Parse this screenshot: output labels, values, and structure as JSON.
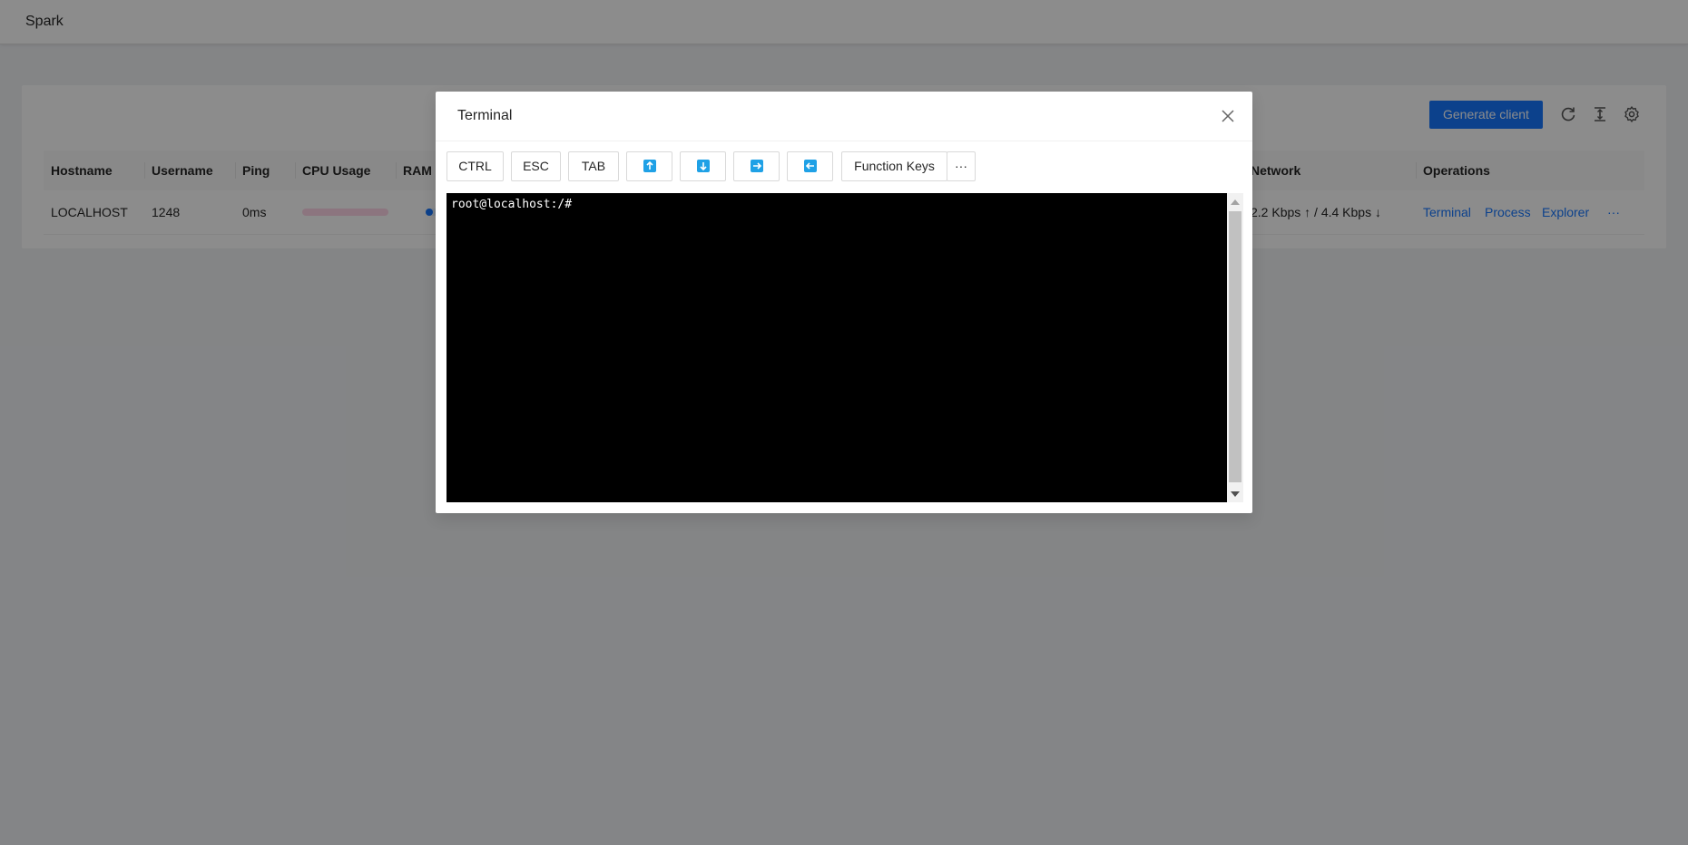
{
  "app": {
    "title": "Spark"
  },
  "toolbar": {
    "generate_label": "Generate client",
    "icons": [
      "reload-icon",
      "column-height-icon",
      "settings-icon"
    ]
  },
  "table": {
    "columns": [
      "Hostname",
      "Username",
      "Ping",
      "CPU Usage",
      "RAM",
      "Network",
      "Operations"
    ],
    "rows": [
      {
        "hostname": "LOCALHOST",
        "username": "1248",
        "ping": "0ms",
        "cpu_usage_fraction": 0.0,
        "ram_usage_fraction": 0.05,
        "network": "2.2 Kbps ↑ / 4.4 Kbps ↓",
        "operations": [
          "Terminal",
          "Process",
          "Explorer",
          "···"
        ]
      }
    ]
  },
  "colors": {
    "primary": "#1677ff",
    "progress_track": "#ffd6e7",
    "terminal_bg": "#000000",
    "arrow_key": "#1fa1e6"
  },
  "modal": {
    "title": "Terminal",
    "keys": {
      "ctrl": "CTRL",
      "esc": "ESC",
      "tab": "TAB",
      "function_keys": "Function Keys",
      "more": "···"
    },
    "arrow_keys": [
      "arrow-up-icon",
      "arrow-down-icon",
      "arrow-right-icon",
      "arrow-left-icon"
    ],
    "terminal": {
      "prompt": "root@localhost:/#"
    }
  }
}
